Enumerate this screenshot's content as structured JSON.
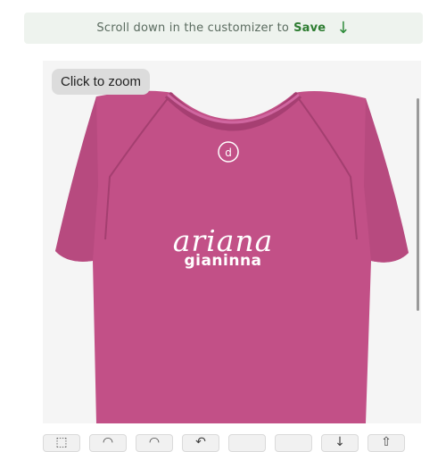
{
  "banner": {
    "prefix": "Scroll down in the customizer to",
    "save_label": "Save",
    "arrow": "↓"
  },
  "preview": {
    "zoom_label": "Click to zoom",
    "garment_color": "#c25087",
    "logo_text": "d",
    "name_script": "ariana",
    "name_sub": "gianinna"
  },
  "toolbar": {
    "tools": [
      {
        "icon": "⬚",
        "name": "select-tool-icon"
      },
      {
        "icon": "◠",
        "name": "arc-tool-icon"
      },
      {
        "icon": "◠",
        "name": "curve-tool-icon"
      },
      {
        "icon": "↶",
        "name": "rotate-icon"
      },
      {
        "icon": "",
        "name": "blank-tool-icon"
      },
      {
        "icon": "",
        "name": "blank-tool-icon-2"
      },
      {
        "icon": "↓",
        "name": "move-down-icon"
      },
      {
        "icon": "⇧",
        "name": "move-up-icon"
      }
    ]
  }
}
